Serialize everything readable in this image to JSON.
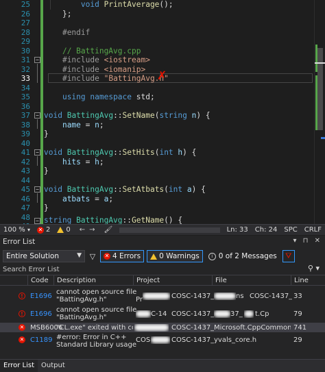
{
  "editor": {
    "line_numbers": [
      "25",
      "26",
      "27",
      "28",
      "29",
      "30",
      "31",
      "32",
      "33",
      "34",
      "35",
      "36",
      "37",
      "38",
      "39",
      "40",
      "41",
      "42",
      "43",
      "44",
      "45",
      "46",
      "47",
      "48",
      "49"
    ],
    "active_line": "33",
    "code": {
      "l25_fn": "PrintAverage",
      "l25_kw": "void",
      "l25_rest": "();",
      "l26": "};",
      "l28": "#endif",
      "l30": "// BattingAvg.cpp",
      "l31_pp": "#include",
      "l31_str": "<iostream>",
      "l32_pp": "#include",
      "l32_str": "<iomanip>",
      "l33_pp": "#include",
      "l33_str": "\"BattingAvg.h\"",
      "l35_kw1": "using",
      "l35_kw2": "namespace",
      "l35_rest": "std;",
      "l37_kw": "void",
      "l37_ty": "BattingAvg",
      "l37_sep": "::",
      "l37_fn": "SetName",
      "l37_p1": "(",
      "l37_ty2": "string",
      "l37_pr": "n",
      "l37_end": ") {",
      "l38_pr1": "name",
      "l38_op": " = ",
      "l38_pr2": "n",
      "l38_end": ";",
      "brace_open": "{",
      "brace_close": "}",
      "l41_kw": "void",
      "l41_ty": "BattingAvg",
      "l41_sep": "::",
      "l41_fn": "SetHits",
      "l41_p1": "(",
      "l41_kw2": "int",
      "l41_pr": "h",
      "l41_end": ") {",
      "l42_pr1": "hits",
      "l42_op": " = ",
      "l42_pr2": "h",
      "l42_end": ";",
      "l45_kw": "void",
      "l45_ty": "BattingAvg",
      "l45_sep": "::",
      "l45_fn": "SetAtbats",
      "l45_p1": "(",
      "l45_kw2": "int",
      "l45_pr": "a",
      "l45_end": ") {",
      "l46_pr1": "atbats",
      "l46_op": " = ",
      "l46_pr2": "a",
      "l46_end": ";",
      "l49_ty": "string",
      "l49_ty2": "BattingAvg",
      "l49_sep": "::",
      "l49_fn": "GetName",
      "l49_end": "() {"
    },
    "marker": "✗"
  },
  "editor_status": {
    "zoom": "100 %",
    "errors": "2",
    "warnings": "0",
    "line": "Ln: 33",
    "col": "Ch: 24",
    "whitespace": "SPC",
    "line_endings": "CRLF"
  },
  "error_list": {
    "title": "Error List",
    "scope": "Entire Solution",
    "errors_filter": "4 Errors",
    "warnings_filter": "0 Warnings",
    "messages_filter": "0 of 2 Messages",
    "search_placeholder": "Search Error List",
    "columns": [
      "Code",
      "Description",
      "Project",
      "File",
      "Line"
    ],
    "rows": [
      {
        "code": "E1696",
        "desc1": "cannot open source file",
        "desc2": "\"BattingAvg.h\"",
        "project_suffix": "COSC-1437_",
        "project_frag": "Pr",
        "file_mid": "ns",
        "file_suffix": "COSC-1437_",
        "line": "33"
      },
      {
        "code": "E1696",
        "desc1": "cannot open source file",
        "desc2": "\"BattingAvg.h\"",
        "project_suffix": "COSC-1437_",
        "project_frag": "C-14",
        "file_mid": "37_",
        "file_suffix": "t.Cp",
        "line": "79"
      },
      {
        "code": "MSB6006",
        "desc1": "\"CL.exe\" exited with code 2.",
        "desc2": "",
        "project_suffix": "COSC-1437_",
        "project_frag": "",
        "file_mid": "",
        "file_suffix": "Microsoft.CppCommon.t...",
        "line": "741"
      },
      {
        "code": "C1189",
        "desc1": "#error:  Error in C++",
        "desc2": "Standard Library usage",
        "project_suffix": "COSC-1437_",
        "project_frag": "COS",
        "file_mid": "",
        "file_suffix": "yvals_core.h",
        "line": "29"
      }
    ]
  },
  "bottom_tabs": [
    "Error List",
    "Output"
  ],
  "icons": {
    "error": "error-circle-icon",
    "warning": "warning-triangle-icon",
    "message": "info-circle-icon",
    "filter": "funnel-icon",
    "search": "search-icon",
    "clear_filter": "clear-filter-icon"
  },
  "colors": {
    "editor_bg": "#1e1e1e",
    "keyword": "#569cd6",
    "type": "#4ec9b0",
    "function": "#dcdcaa",
    "string": "#d69d85",
    "comment": "#57a64a",
    "error": "#e51400",
    "accent": "#3399ff"
  }
}
